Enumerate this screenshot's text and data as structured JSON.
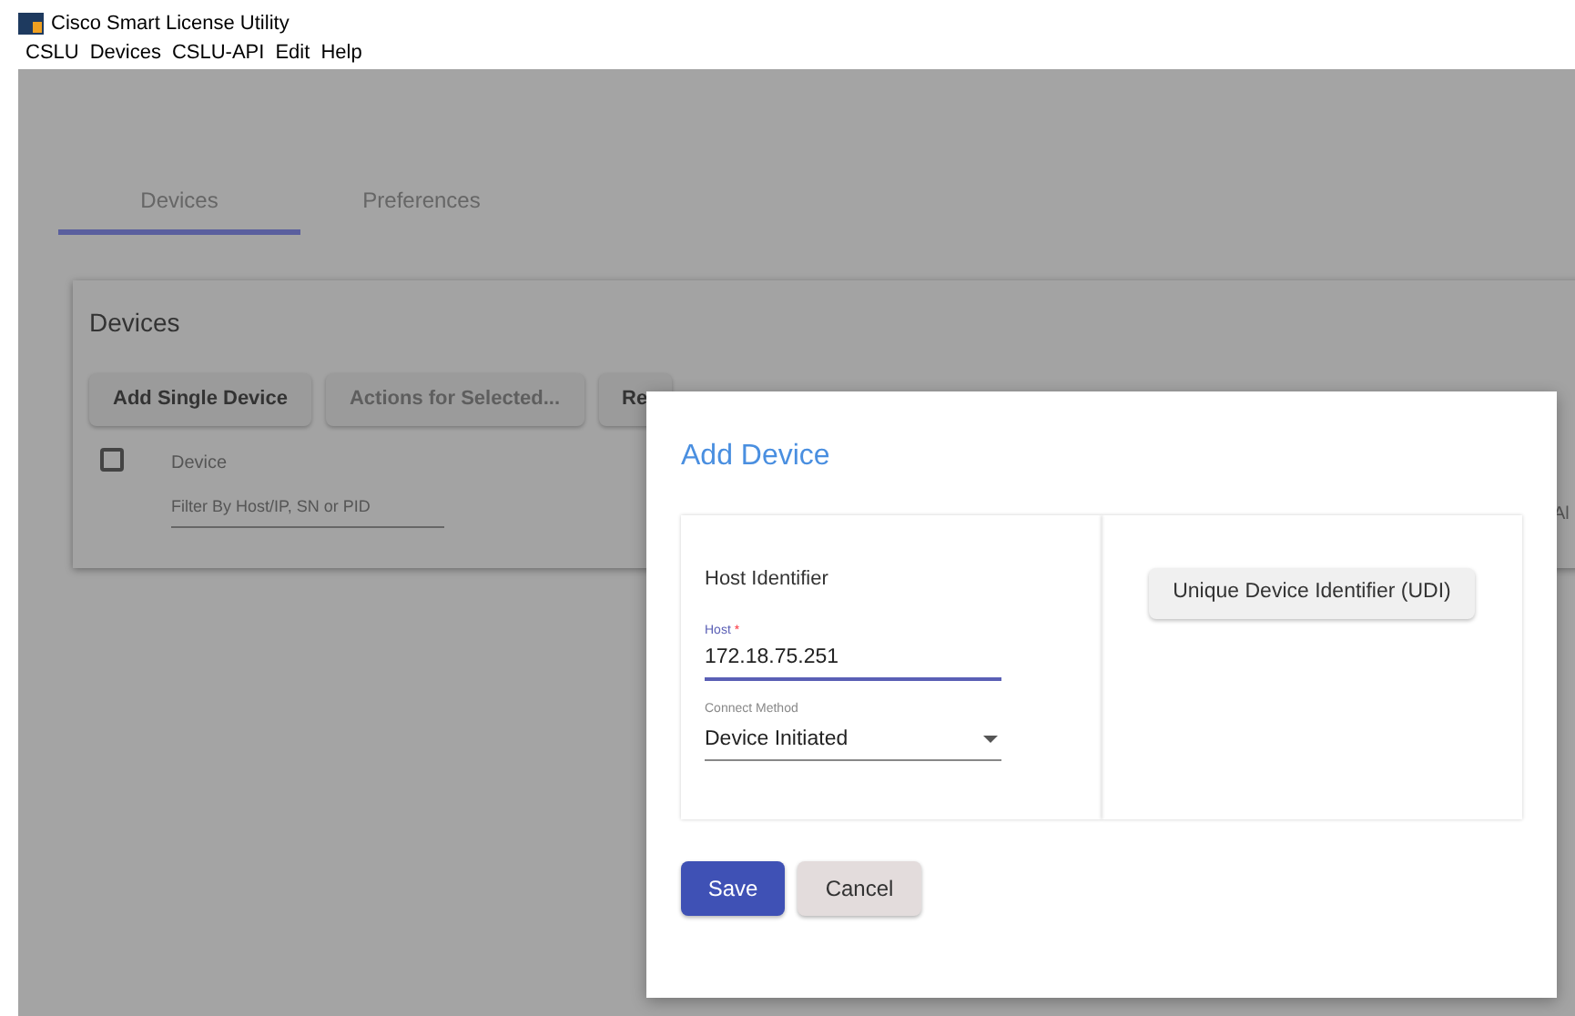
{
  "window": {
    "title": "Cisco Smart License Utility"
  },
  "menu": [
    "CSLU",
    "Devices",
    "CSLU-API",
    "Edit",
    "Help"
  ],
  "tabs": [
    {
      "label": "Devices",
      "selected": true
    },
    {
      "label": "Preferences",
      "selected": false
    }
  ],
  "devices_card": {
    "title": "Devices",
    "buttons": [
      {
        "label": "Add Single Device",
        "disabled": false
      },
      {
        "label": "Actions for Selected...",
        "disabled": true
      },
      {
        "label": "Re",
        "disabled": false
      }
    ],
    "select_all": {
      "checked": false
    },
    "column": "Device",
    "filter": {
      "placeholder": "Filter By Host/IP, SN or PID"
    },
    "column_2": "Al"
  },
  "dialog": {
    "title": "Add Device",
    "section": "Host Identifier",
    "host": {
      "label": "Host",
      "required_mark": "*",
      "value": "172.18.75.251"
    },
    "connect_method": {
      "label": "Connect Method",
      "value": "Device Initiated"
    },
    "udi_button": "Unique Device Identifier (UDI)",
    "save": "Save",
    "cancel": "Cancel"
  }
}
